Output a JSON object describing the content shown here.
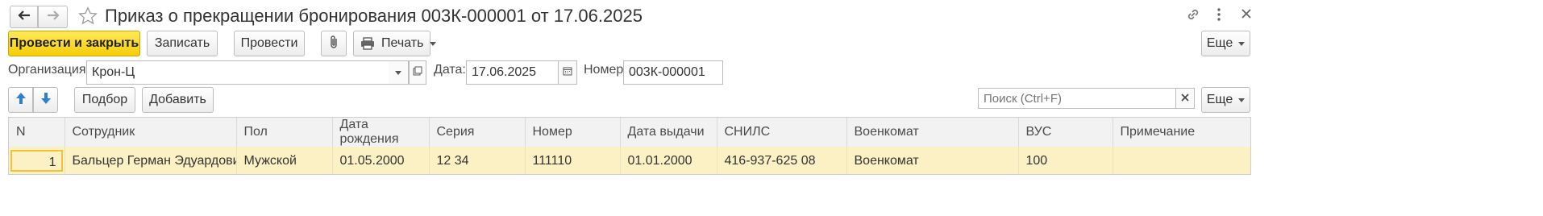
{
  "title": "Приказ о прекращении бронирования 003К-000001 от 17.06.2025",
  "toolbar": {
    "post_close": "Провести и закрыть",
    "save": "Записать",
    "post": "Провести",
    "print": "Печать",
    "more": "Еще"
  },
  "header": {
    "org_label": "Организация:",
    "org_value": "Крон-Ц",
    "date_label": "Дата:",
    "date_value": "17.06.2025",
    "number_label": "Номер:",
    "number_value": "003К-000001"
  },
  "table_toolbar": {
    "pick": "Подбор",
    "add": "Добавить",
    "search_placeholder": "Поиск (Ctrl+F)",
    "more": "Еще"
  },
  "table": {
    "columns": [
      "N",
      "Сотрудник",
      "Пол",
      "Дата рождения",
      "Серия",
      "Номер",
      "Дата выдачи",
      "СНИЛС",
      "Военкомат",
      "ВУС",
      "Примечание"
    ],
    "rows": [
      [
        "1",
        "Бальцер Герман Эдуардович",
        "Мужской",
        "01.05.2000",
        "12 34",
        "111110",
        "01.01.2000",
        "416-937-625 08",
        "Военкомат",
        "100",
        ""
      ]
    ]
  },
  "colors": {
    "accent": "#f5cd0a",
    "selected_row": "#fbf1c4"
  }
}
